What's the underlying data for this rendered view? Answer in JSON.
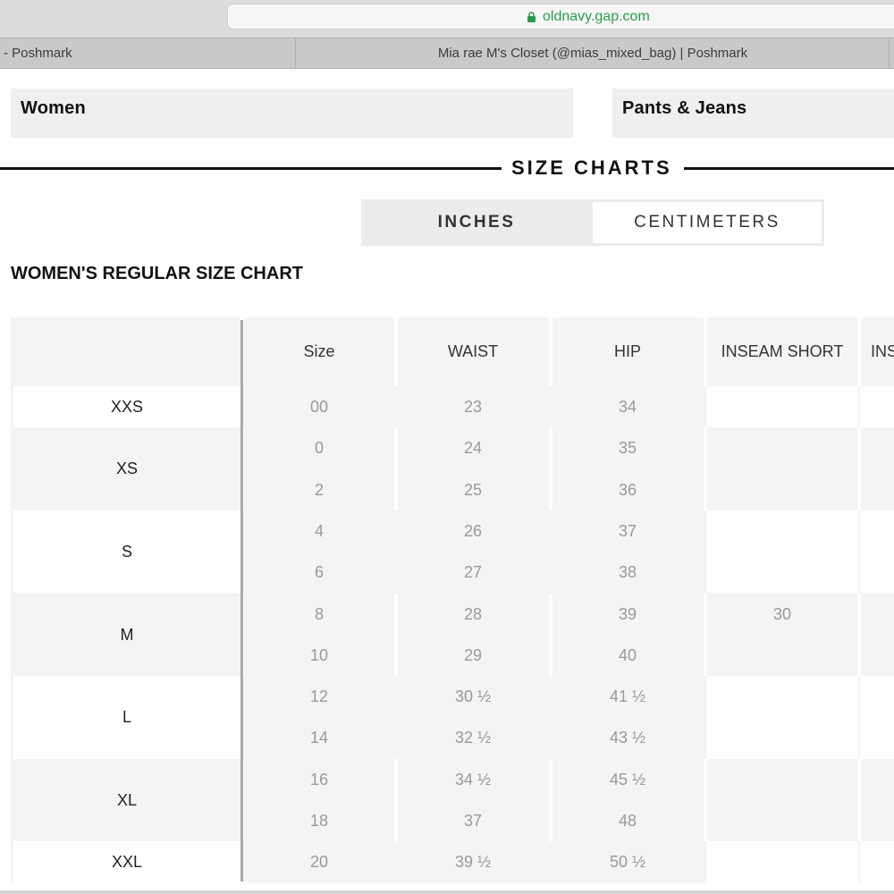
{
  "browser": {
    "url": "oldnavy.gap.com",
    "tabs": [
      "- Poshmark",
      "Mia rae M's Closet (@mias_mixed_bag) | Poshmark"
    ]
  },
  "categories": {
    "department": "Women",
    "product": "Pants & Jeans"
  },
  "size_charts": {
    "title": "SIZE CHARTS",
    "units": {
      "selected": "INCHES",
      "other": "CENTIMETERS"
    },
    "chart_title": "WOMEN'S REGULAR SIZE CHART",
    "columns": [
      "Size",
      "WAIST",
      "HIP",
      "INSEAM SHORT",
      "INS"
    ],
    "groups": [
      {
        "label": "XXS",
        "rows": [
          {
            "size": "00",
            "waist": "23",
            "hip": "34",
            "inseam_short": ""
          }
        ]
      },
      {
        "label": "XS",
        "rows": [
          {
            "size": "0",
            "waist": "24",
            "hip": "35",
            "inseam_short": ""
          },
          {
            "size": "2",
            "waist": "25",
            "hip": "36",
            "inseam_short": ""
          }
        ]
      },
      {
        "label": "S",
        "rows": [
          {
            "size": "4",
            "waist": "26",
            "hip": "37",
            "inseam_short": ""
          },
          {
            "size": "6",
            "waist": "27",
            "hip": "38",
            "inseam_short": ""
          }
        ]
      },
      {
        "label": "M",
        "rows": [
          {
            "size": "8",
            "waist": "28",
            "hip": "39",
            "inseam_short": "30"
          },
          {
            "size": "10",
            "waist": "29",
            "hip": "40",
            "inseam_short": ""
          }
        ]
      },
      {
        "label": "L",
        "rows": [
          {
            "size": "12",
            "waist": "30 ½",
            "hip": "41 ½",
            "inseam_short": ""
          },
          {
            "size": "14",
            "waist": "32 ½",
            "hip": "43 ½",
            "inseam_short": ""
          }
        ]
      },
      {
        "label": "XL",
        "rows": [
          {
            "size": "16",
            "waist": "34 ½",
            "hip": "45 ½",
            "inseam_short": ""
          },
          {
            "size": "18",
            "waist": "37",
            "hip": "48",
            "inseam_short": ""
          }
        ]
      },
      {
        "label": "XXL",
        "rows": [
          {
            "size": "20",
            "waist": "39 ½",
            "hip": "50 ½",
            "inseam_short": ""
          }
        ]
      }
    ]
  },
  "colors": {
    "url_green": "#2a9d4b",
    "table_bg": "#f4f4f4",
    "value_text": "#999999"
  }
}
